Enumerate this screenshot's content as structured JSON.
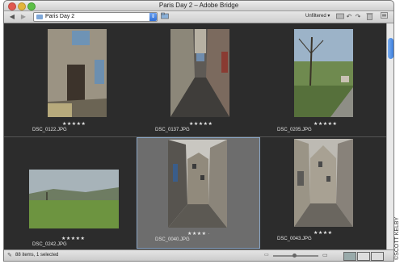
{
  "window": {
    "title": "Paris Day 2 – Adobe Bridge"
  },
  "toolbar": {
    "back_icon": "left-arrow-icon",
    "forward_icon": "right-arrow-icon",
    "path_value": "Paris Day 2",
    "filter_label": "Unfiltered",
    "filter_arrow": "▾"
  },
  "thumbnails": [
    {
      "name": "DSC_0122.JPG",
      "stars": "★★★★★"
    },
    {
      "name": "DSC_0137.JPG",
      "stars": "★★★★★"
    },
    {
      "name": "DSC_0205.JPG",
      "stars": "★★★★★"
    },
    {
      "name": "DSC_0242.JPG",
      "stars": "★★★★★"
    },
    {
      "name": "DSC_0040.JPG",
      "stars": "★★★★ ·"
    },
    {
      "name": "DSC_0043.JPG",
      "stars": "★★★★"
    }
  ],
  "status": {
    "text": "88 items, 1 selected"
  },
  "credit": {
    "text": "©SCOTT KELBY"
  },
  "colors": {
    "selection": "#6d6d6d",
    "background": "#2c2c2c",
    "accent": "#3b7ddc"
  }
}
